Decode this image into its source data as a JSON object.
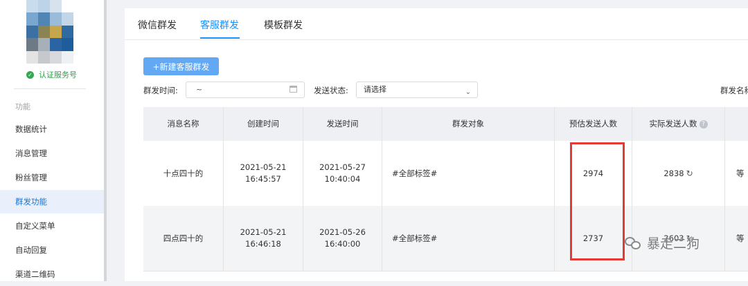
{
  "sidebar": {
    "verified_label": "认证服务号",
    "section_label": "功能",
    "items": [
      {
        "label": "数据统计"
      },
      {
        "label": "消息管理"
      },
      {
        "label": "粉丝管理"
      },
      {
        "label": "群发功能",
        "active": true
      },
      {
        "label": "自定义菜单"
      },
      {
        "label": "自动回复"
      },
      {
        "label": "渠道二维码"
      }
    ]
  },
  "tabs": [
    {
      "label": "微信群发"
    },
    {
      "label": "客服群发",
      "active": true
    },
    {
      "label": "模板群发"
    }
  ],
  "toolbar": {
    "new_button": "+新建客服群发"
  },
  "filters": {
    "time_label": "群发时间:",
    "time_value": "~",
    "status_label": "发送状态:",
    "status_value": "请选择",
    "name_label": "群发名称"
  },
  "table": {
    "headers": [
      "消息名称",
      "创建时间",
      "发送时间",
      "群发对象",
      "预估发送人数",
      "实际发送人数",
      ""
    ],
    "rows": [
      {
        "name": "十点四十的",
        "created_date": "2021-05-21",
        "created_time": "16:45:57",
        "sent_date": "2021-05-27",
        "sent_time": "10:40:04",
        "target": "#全部标签#",
        "estimated": "2974",
        "actual": "2838",
        "status": "等"
      },
      {
        "name": "四点四十的",
        "created_date": "2021-05-21",
        "created_time": "16:46:18",
        "sent_date": "2021-05-26",
        "sent_time": "16:40:00",
        "target": "#全部标签#",
        "estimated": "2737",
        "actual": "2603",
        "status": "等"
      }
    ]
  },
  "watermark": {
    "text": "暴走二狗"
  },
  "colors": {
    "accent": "#1890ff",
    "button": "#62a8f2",
    "highlight": "#e53935",
    "verified": "#2e9e4a"
  }
}
